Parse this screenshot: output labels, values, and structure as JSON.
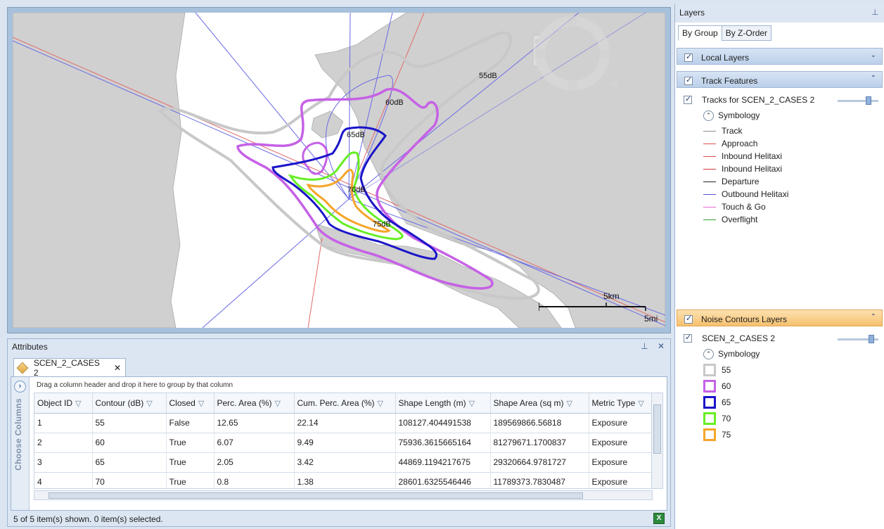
{
  "map": {
    "contour_labels": [
      "55dB",
      "60dB",
      "65dB",
      "70dB",
      "75dB"
    ],
    "scale": {
      "km_label": "5km",
      "mi_label": "5mi"
    },
    "colors": {
      "land": "#d0d0d0",
      "c55": "#c8c8c8",
      "c60": "#c661e6",
      "c65": "#1a14c8",
      "c70": "#66ee22",
      "c75": "#f5a52a",
      "track_blue": "#6a6ae6",
      "track_red": "#e46a6a"
    }
  },
  "attributes": {
    "title": "Attributes",
    "tab_label": "SCEN_2_CASES 2",
    "group_hint": "Drag a column header and drop it here to group by that column",
    "choose_columns": "Choose Columns",
    "columns": [
      "Object ID",
      "Contour (dB)",
      "Closed",
      "Perc. Area (%)",
      "Cum. Perc. Area (%)",
      "Shape Length (m)",
      "Shape Area (sq m)",
      "Metric Type"
    ],
    "rows": [
      [
        "1",
        "55",
        "False",
        "12.65",
        "22.14",
        "108127.404491538",
        "189569866.56818",
        "Exposure"
      ],
      [
        "2",
        "60",
        "True",
        "6.07",
        "9.49",
        "75936.3615665164",
        "81279671.1700837",
        "Exposure"
      ],
      [
        "3",
        "65",
        "True",
        "2.05",
        "3.42",
        "44869.1194217675",
        "29320664.9781727",
        "Exposure"
      ],
      [
        "4",
        "70",
        "True",
        "0.8",
        "1.38",
        "28601.6325546446",
        "11789373.7830487",
        "Exposure"
      ]
    ],
    "status": "5 of 5 item(s) shown. 0 item(s) selected."
  },
  "layers": {
    "title": "Layers",
    "tabs": [
      "By Group",
      "By Z-Order"
    ],
    "groups": {
      "local": "Local Layers",
      "track": "Track Features",
      "noise": "Noise Contours Layers"
    },
    "track_layer": "Tracks for SCEN_2_CASES 2",
    "symbology": "Symbology",
    "track_legend": [
      {
        "label": "Track",
        "color": "#8a8a8a"
      },
      {
        "label": "Approach",
        "color": "#e05050"
      },
      {
        "label": "Inbound Helitaxi",
        "color": "#e05050"
      },
      {
        "label": "Inbound Helitaxi",
        "color": "#d83a3a"
      },
      {
        "label": "Departure",
        "color": "#222222"
      },
      {
        "label": "Outbound Helitaxi",
        "color": "#5555dd"
      },
      {
        "label": "Touch & Go",
        "color": "#e36ad8"
      },
      {
        "label": "Overflight",
        "color": "#2f9e2f"
      }
    ],
    "noise_layer": "SCEN_2_CASES 2",
    "noise_legend": [
      {
        "label": "55",
        "color": "#c8c8c8"
      },
      {
        "label": "60",
        "color": "#c661e6"
      },
      {
        "label": "65",
        "color": "#1a14c8"
      },
      {
        "label": "70",
        "color": "#66ee22"
      },
      {
        "label": "75",
        "color": "#f5a52a"
      }
    ]
  }
}
